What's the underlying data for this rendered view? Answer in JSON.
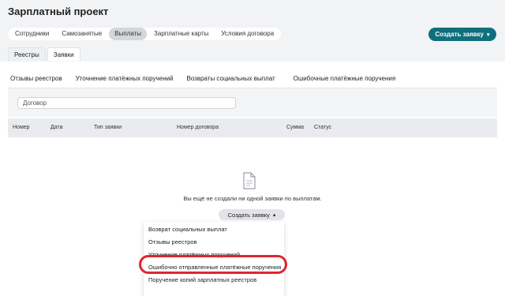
{
  "page_title": "Зарплатный проект",
  "nav_tabs": [
    {
      "label": "Сотрудники",
      "active": false
    },
    {
      "label": "Самозанятые",
      "active": false
    },
    {
      "label": "Выплаты",
      "active": true
    },
    {
      "label": "Зарплатные карты",
      "active": false
    },
    {
      "label": "Условия договора",
      "active": false
    }
  ],
  "create_button": {
    "label": "Создать заявку"
  },
  "sub_tabs": [
    {
      "label": "Реестры",
      "active": false
    },
    {
      "label": "Заявки",
      "active": true
    }
  ],
  "type_tabs": [
    {
      "label": "Отзывы реестров",
      "active": false
    },
    {
      "label": "Уточнение платёжных поручений",
      "active": false
    },
    {
      "label": "Возвраты социальных выплат",
      "active": false
    },
    {
      "label": "Ошибочные платёжные поручения",
      "active": true
    }
  ],
  "search": {
    "placeholder": "Договор"
  },
  "table": {
    "columns": [
      "Номер",
      "Дата",
      "Тип заявки",
      "Номер договора",
      "Сумма",
      "Статус"
    ]
  },
  "empty_state": {
    "icon": "document-icon",
    "text": "Вы ещё не создали ни одной заявки по выплатам."
  },
  "create_button_2": {
    "label": "Создать заявку"
  },
  "dropdown": {
    "items": [
      "Возврат социальных выплат",
      "Отзывы реестров",
      "Уточнение платёжных поручений",
      "Ошибочно отправленные платёжные поручения",
      "Поручение копий зарплатных реестров"
    ],
    "highlighted_index": 3
  },
  "colors": {
    "accent": "#0f6f7d",
    "highlight": "#e0262d"
  }
}
